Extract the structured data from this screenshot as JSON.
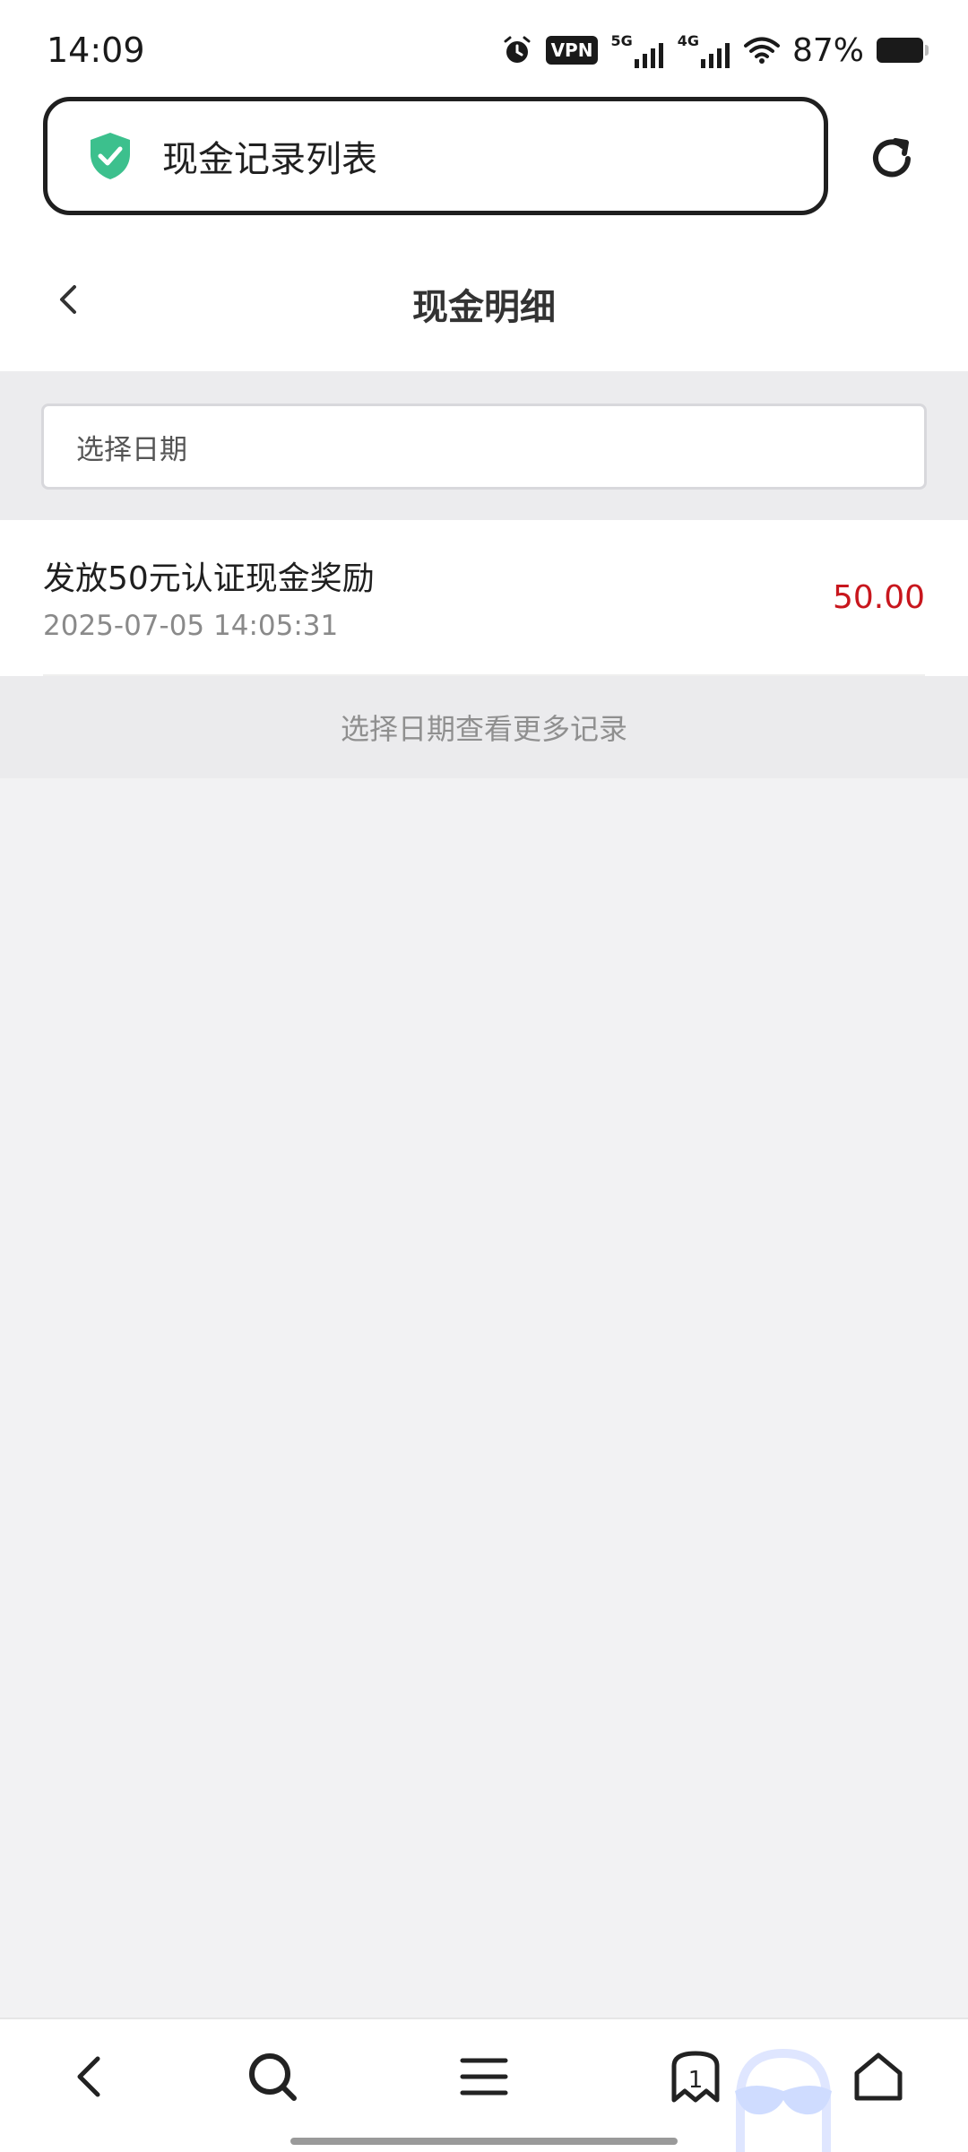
{
  "status_bar": {
    "time": "14:09",
    "vpn": "VPN",
    "network_1": "5G",
    "network_2": "4G",
    "battery_percent": "87%",
    "icons": [
      "alarm-icon",
      "vpn-icon",
      "signal-5g-icon",
      "signal-4g-icon",
      "wifi-icon",
      "battery-icon"
    ]
  },
  "browser": {
    "page_label": "现金记录列表",
    "secure_icon": "shield-check-icon",
    "reload_icon": "reload-icon",
    "accent_color": "#3cc08d"
  },
  "header": {
    "title": "现金明细",
    "back_icon": "chevron-left-icon"
  },
  "filter": {
    "date_placeholder": "选择日期"
  },
  "records": [
    {
      "title": "发放50元认证现金奖励",
      "time": "2025-07-05 14:05:31",
      "amount": "50.00",
      "amount_color": "#c8161d"
    }
  ],
  "more_hint": "选择日期查看更多记录",
  "toolbar": {
    "items": [
      "back-icon",
      "search-icon",
      "menu-icon",
      "tabs-icon",
      "home-icon"
    ],
    "tab_count": "1"
  }
}
